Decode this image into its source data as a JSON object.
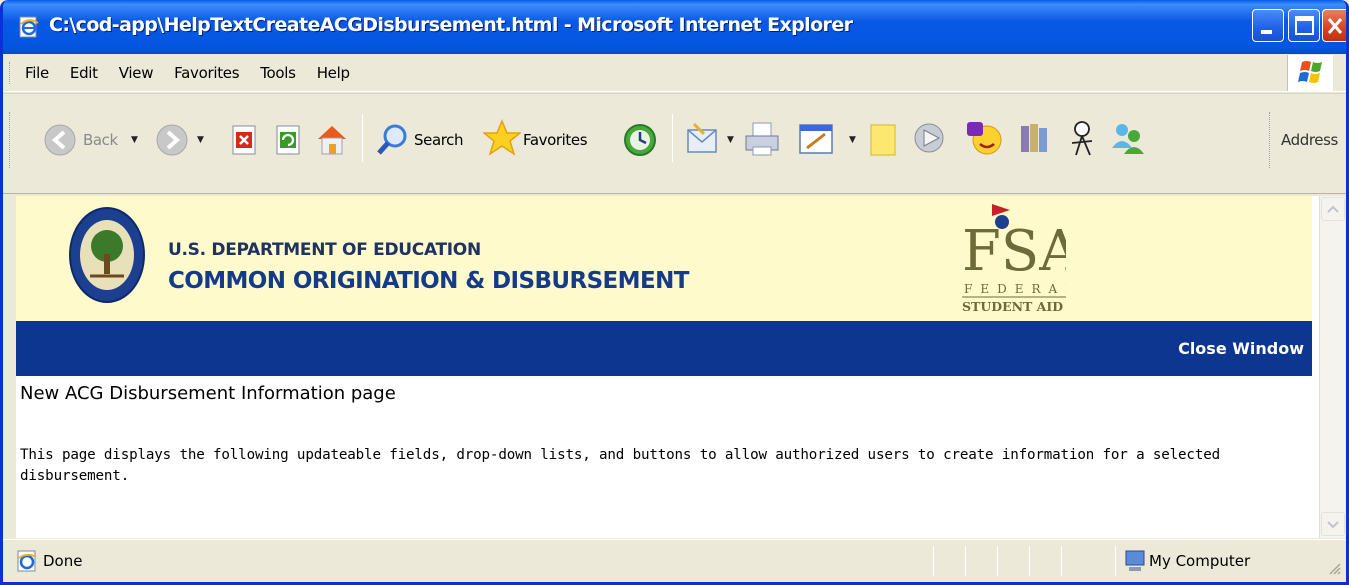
{
  "window": {
    "title": "C:\\cod-app\\HelpTextCreateACGDisbursement.html - Microsoft Internet Explorer"
  },
  "menu": {
    "items": [
      {
        "label": "File"
      },
      {
        "label": "Edit"
      },
      {
        "label": "View"
      },
      {
        "label": "Favorites"
      },
      {
        "label": "Tools"
      },
      {
        "label": "Help"
      }
    ]
  },
  "toolbar": {
    "back_label": "Back",
    "search_label": "Search",
    "favorites_label": "Favorites",
    "address_label": "Address",
    "icons": [
      "back-icon",
      "forward-icon",
      "stop-icon",
      "refresh-icon",
      "home-icon",
      "search-icon",
      "favorites-icon",
      "history-icon",
      "mail-icon",
      "print-icon",
      "edit-icon",
      "notes-icon",
      "media-icon",
      "messenger-icon",
      "research-icon",
      "user-icon",
      "contacts-icon"
    ]
  },
  "banner": {
    "dept_line1": "U.S. DEPARTMENT OF EDUCATION",
    "dept_line2": "COMMON ORIGINATION & DISBURSEMENT",
    "seal_text_top": "DEPARTMENT OF EDUCATION",
    "seal_text_bottom": "UNITED STATES OF AMERICA",
    "fsa_logo_text": "FSA",
    "fsa_logo_sub1": "FEDERAL",
    "fsa_logo_sub2": "STUDENT AID"
  },
  "nav": {
    "close_window_label": "Close Window"
  },
  "page": {
    "heading": "New ACG Disbursement Information page",
    "description": "This page displays the following updateable fields, drop-down lists, and buttons to allow authorized users to create information for a selected disbursement."
  },
  "status": {
    "text": "Done",
    "zone": "My Computer"
  },
  "colors": {
    "titlebar": "#0858e6",
    "banner_bg": "#fffacc",
    "nav_bar": "#0d3691",
    "heading_text": "#143a8a"
  }
}
